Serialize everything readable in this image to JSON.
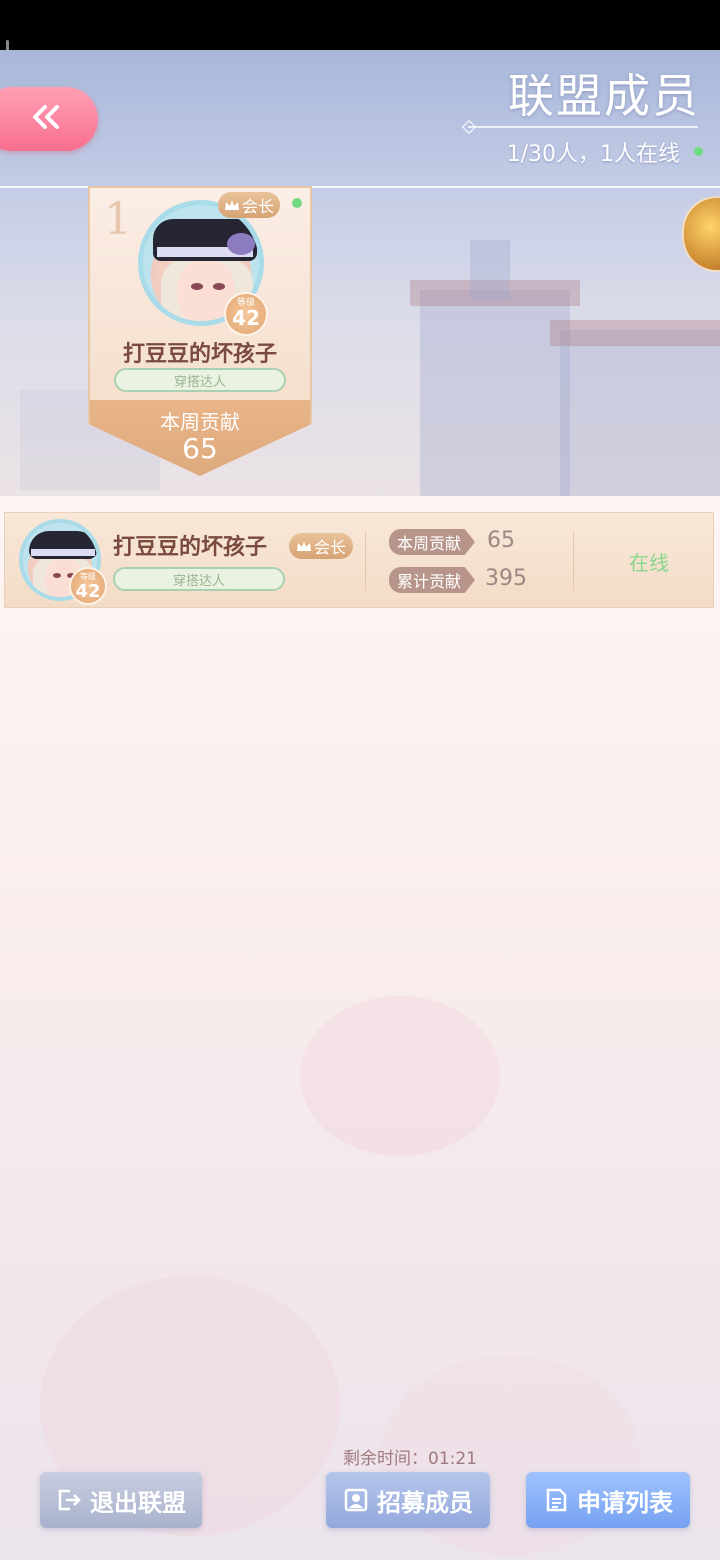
{
  "header": {
    "title": "联盟成员",
    "online_summary": "1/30人，1人在线"
  },
  "top_member": {
    "rank": "1",
    "role_badge": "会长",
    "level_label": "等级",
    "level": "42",
    "name": "打豆豆的坏孩子",
    "title": "穿搭达人",
    "weekly_label": "本周贡献",
    "weekly_value": "65"
  },
  "members": [
    {
      "name": "打豆豆的坏孩子",
      "role_badge": "会长",
      "level_label": "等级",
      "level": "42",
      "title": "穿搭达人",
      "weekly_label": "本周贡献",
      "weekly_value": "65",
      "total_label": "累计贡献",
      "total_value": "395",
      "status": "在线"
    }
  ],
  "footer": {
    "timer": "剩余时间：01:21",
    "quit_label": "退出联盟",
    "recruit_label": "招募成员",
    "apply_label": "申请列表"
  },
  "colors": {
    "accent_pink": "#f86f8e",
    "online_green": "#72d982",
    "apply_blue": "#76a2f1"
  },
  "icons": {
    "back": "double-chevron-left-icon",
    "crown": "crown-icon",
    "quit": "exit-icon",
    "recruit": "person-card-icon",
    "apply": "document-icon",
    "chest": "treasure-chest-icon"
  }
}
